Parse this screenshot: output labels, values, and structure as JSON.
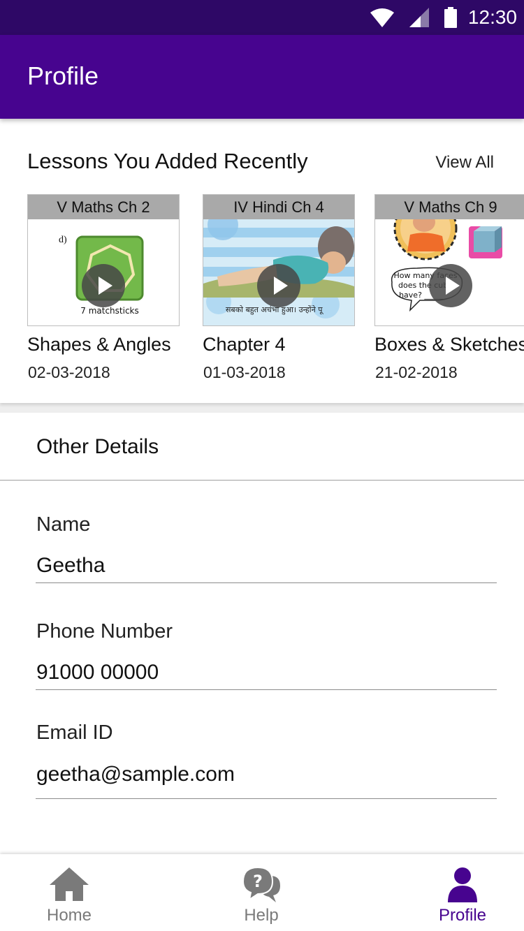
{
  "status_bar": {
    "time": "12:30",
    "icons": [
      "wifi-icon",
      "signal-icon",
      "battery-icon"
    ]
  },
  "app_bar": {
    "title": "Profile"
  },
  "recent": {
    "title": "Lessons You Added Recently",
    "view_all": "View All",
    "lessons": [
      {
        "label": "V Maths Ch 2",
        "name": "Shapes & Angles",
        "date": "02-03-2018",
        "art_caption": "7 matchsticks",
        "art_marker": "d)"
      },
      {
        "label": "IV Hindi Ch 4",
        "name": "Chapter 4",
        "date": "01-03-2018",
        "art_caption": "सबको बहुत अचंभा हुआ। उन्होंने पू"
      },
      {
        "label": "V Maths Ch 9",
        "name": "Boxes & Sketches",
        "date": "21-02-2018",
        "art_caption_1": "How many faces",
        "art_caption_2": "does the cube",
        "art_caption_3": "have? _____"
      }
    ]
  },
  "details": {
    "title": "Other Details",
    "fields": [
      {
        "label": "Name",
        "value": "Geetha"
      },
      {
        "label": "Phone Number",
        "value": "91000 00000"
      },
      {
        "label": "Email ID",
        "value": "geetha@sample.com"
      }
    ]
  },
  "nav": {
    "items": [
      {
        "label": "Home",
        "icon": "home-icon"
      },
      {
        "label": "Help",
        "icon": "help-chat-icon"
      },
      {
        "label": "Profile",
        "icon": "person-icon",
        "active": true
      }
    ]
  },
  "colors": {
    "primary": "#47048f",
    "status_bar": "#2e0866",
    "inactive": "#7a7a7a"
  }
}
